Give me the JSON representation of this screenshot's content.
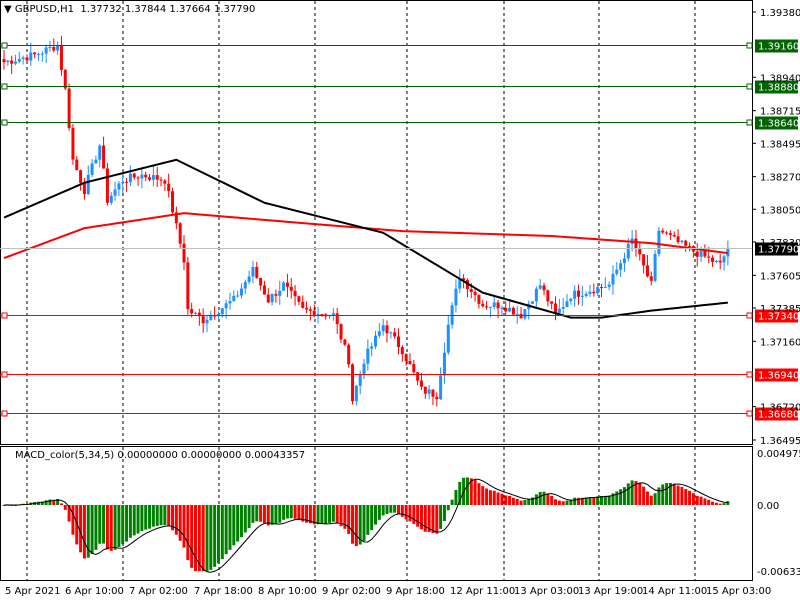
{
  "header": {
    "symbol": "GBPUSD,H1",
    "open": "1.37732",
    "high": "1.37844",
    "low": "1.37664",
    "close": "1.37790"
  },
  "indicator": {
    "name": "MACD_color(5,34,5)",
    "v1": "0.00000000",
    "v2": "0.00000000",
    "v3": "0.00043357"
  },
  "colors": {
    "bull": "#1e90ff",
    "bear": "#ff0000",
    "ma_fast": "#000000",
    "ma_slow": "#ff0000",
    "support": "#ff0000",
    "resistance": "#006400",
    "hist_up": "#008000",
    "hist_down": "#ff0000"
  },
  "chart_data": {
    "type": "candlestick",
    "price_axis": {
      "range": [
        1.36495,
        1.3938
      ],
      "ticks": [
        "1.39380",
        "1.38940",
        "1.38715",
        "1.38495",
        "1.38270",
        "1.38050",
        "1.37830",
        "1.37605",
        "1.37385",
        "1.37160",
        "1.36720",
        "1.36495"
      ]
    },
    "time_axis": {
      "ticks": [
        "5 Apr 2021",
        "6 Apr 10:00",
        "7 Apr 02:00",
        "7 Apr 18:00",
        "8 Apr 10:00",
        "9 Apr 02:00",
        "9 Apr 18:00",
        "12 Apr 11:00",
        "13 Apr 03:00",
        "13 Apr 19:00",
        "14 Apr 11:00",
        "15 Apr 03:00"
      ],
      "bars": 190
    },
    "close_path": [
      [
        0,
        1.39043
      ],
      [
        8,
        1.3909
      ],
      [
        14,
        1.39157
      ],
      [
        16,
        1.38854
      ],
      [
        18,
        1.38382
      ],
      [
        21,
        1.3818
      ],
      [
        25,
        1.38483
      ],
      [
        27,
        1.38113
      ],
      [
        31,
        1.38248
      ],
      [
        36,
        1.38281
      ],
      [
        42,
        1.38248
      ],
      [
        44,
        1.38045
      ],
      [
        47,
        1.37708
      ],
      [
        48,
        1.37371
      ],
      [
        52,
        1.37304
      ],
      [
        60,
        1.37439
      ],
      [
        65,
        1.37641
      ],
      [
        69,
        1.37439
      ],
      [
        73,
        1.3754
      ],
      [
        78,
        1.37371
      ],
      [
        86,
        1.37338
      ],
      [
        90,
        1.37034
      ],
      [
        91,
        1.36765
      ],
      [
        94,
        1.37034
      ],
      [
        99,
        1.3727
      ],
      [
        104,
        1.37102
      ],
      [
        109,
        1.36832
      ],
      [
        113,
        1.36798
      ],
      [
        116,
        1.3727
      ],
      [
        119,
        1.37607
      ],
      [
        125,
        1.37405
      ],
      [
        130,
        1.37405
      ],
      [
        135,
        1.37338
      ],
      [
        140,
        1.3754
      ],
      [
        144,
        1.37338
      ],
      [
        148,
        1.37472
      ],
      [
        153,
        1.37506
      ],
      [
        158,
        1.3754
      ],
      [
        164,
        1.37843
      ],
      [
        169,
        1.3754
      ],
      [
        171,
        1.37911
      ],
      [
        177,
        1.37809
      ],
      [
        182,
        1.37742
      ],
      [
        187,
        1.37675
      ],
      [
        189,
        1.3779
      ]
    ],
    "ma_fast_path": [
      [
        0,
        1.37994
      ],
      [
        21,
        1.38229
      ],
      [
        45,
        1.38384
      ],
      [
        68,
        1.38094
      ],
      [
        99,
        1.37892
      ],
      [
        125,
        1.37488
      ],
      [
        148,
        1.3732
      ],
      [
        156,
        1.3732
      ],
      [
        169,
        1.37367
      ],
      [
        189,
        1.37421
      ]
    ],
    "ma_slow_path": [
      [
        0,
        1.37721
      ],
      [
        21,
        1.37923
      ],
      [
        47,
        1.38024
      ],
      [
        78,
        1.37957
      ],
      [
        104,
        1.37903
      ],
      [
        143,
        1.3787
      ],
      [
        169,
        1.37822
      ],
      [
        189,
        1.37755
      ]
    ],
    "levels": [
      {
        "price": 1.3916,
        "label": "1.39160",
        "kind": "resistance"
      },
      {
        "price": 1.3888,
        "label": "1.38880",
        "kind": "resistance"
      },
      {
        "price": 1.3864,
        "label": "1.38640",
        "kind": "resistance"
      },
      {
        "price": 1.3734,
        "label": "1.37340",
        "kind": "support"
      },
      {
        "price": 1.3694,
        "label": "1.36940",
        "kind": "support"
      },
      {
        "price": 1.3668,
        "label": "1.36680",
        "kind": "support"
      }
    ],
    "bid": {
      "price": 1.3779,
      "label": "1.37790"
    },
    "macd_axis": {
      "range": [
        -0.006332,
        0.0049753
      ],
      "ticks": [
        "0.0049753",
        "0.00",
        "-0.006332"
      ]
    }
  }
}
